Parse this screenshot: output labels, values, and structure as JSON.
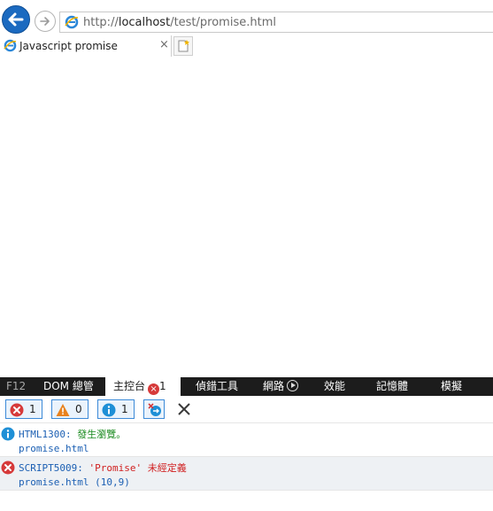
{
  "browser": {
    "url_prefix": "http://",
    "url_host": "localhost",
    "url_path": "/test/promise.html",
    "tab_title": "Javascript promise",
    "tab_close": "×"
  },
  "devtools": {
    "label": "F12",
    "tabs": [
      "DOM 總管",
      "主控台",
      "偵錯工具",
      "網路",
      "效能",
      "記憶體",
      "模擬"
    ],
    "console_error_badge": "1",
    "console_error_badge_icon": "×",
    "filters": {
      "errors": "1",
      "warnings": "0",
      "info": "1"
    },
    "messages": [
      {
        "type": "info",
        "code": "HTML1300:",
        "text": "發生瀏覽。",
        "source": "promise.html"
      },
      {
        "type": "error",
        "code": "SCRIPT5009:",
        "text": "'Promise' 未經定義",
        "source": "promise.html (10,9)"
      }
    ]
  },
  "colors": {
    "accent": "#1b6ac0",
    "error": "#d63a3a",
    "warning": "#e8821e",
    "info": "#1e8fd6",
    "devtools_bar": "#1c1c1c"
  }
}
